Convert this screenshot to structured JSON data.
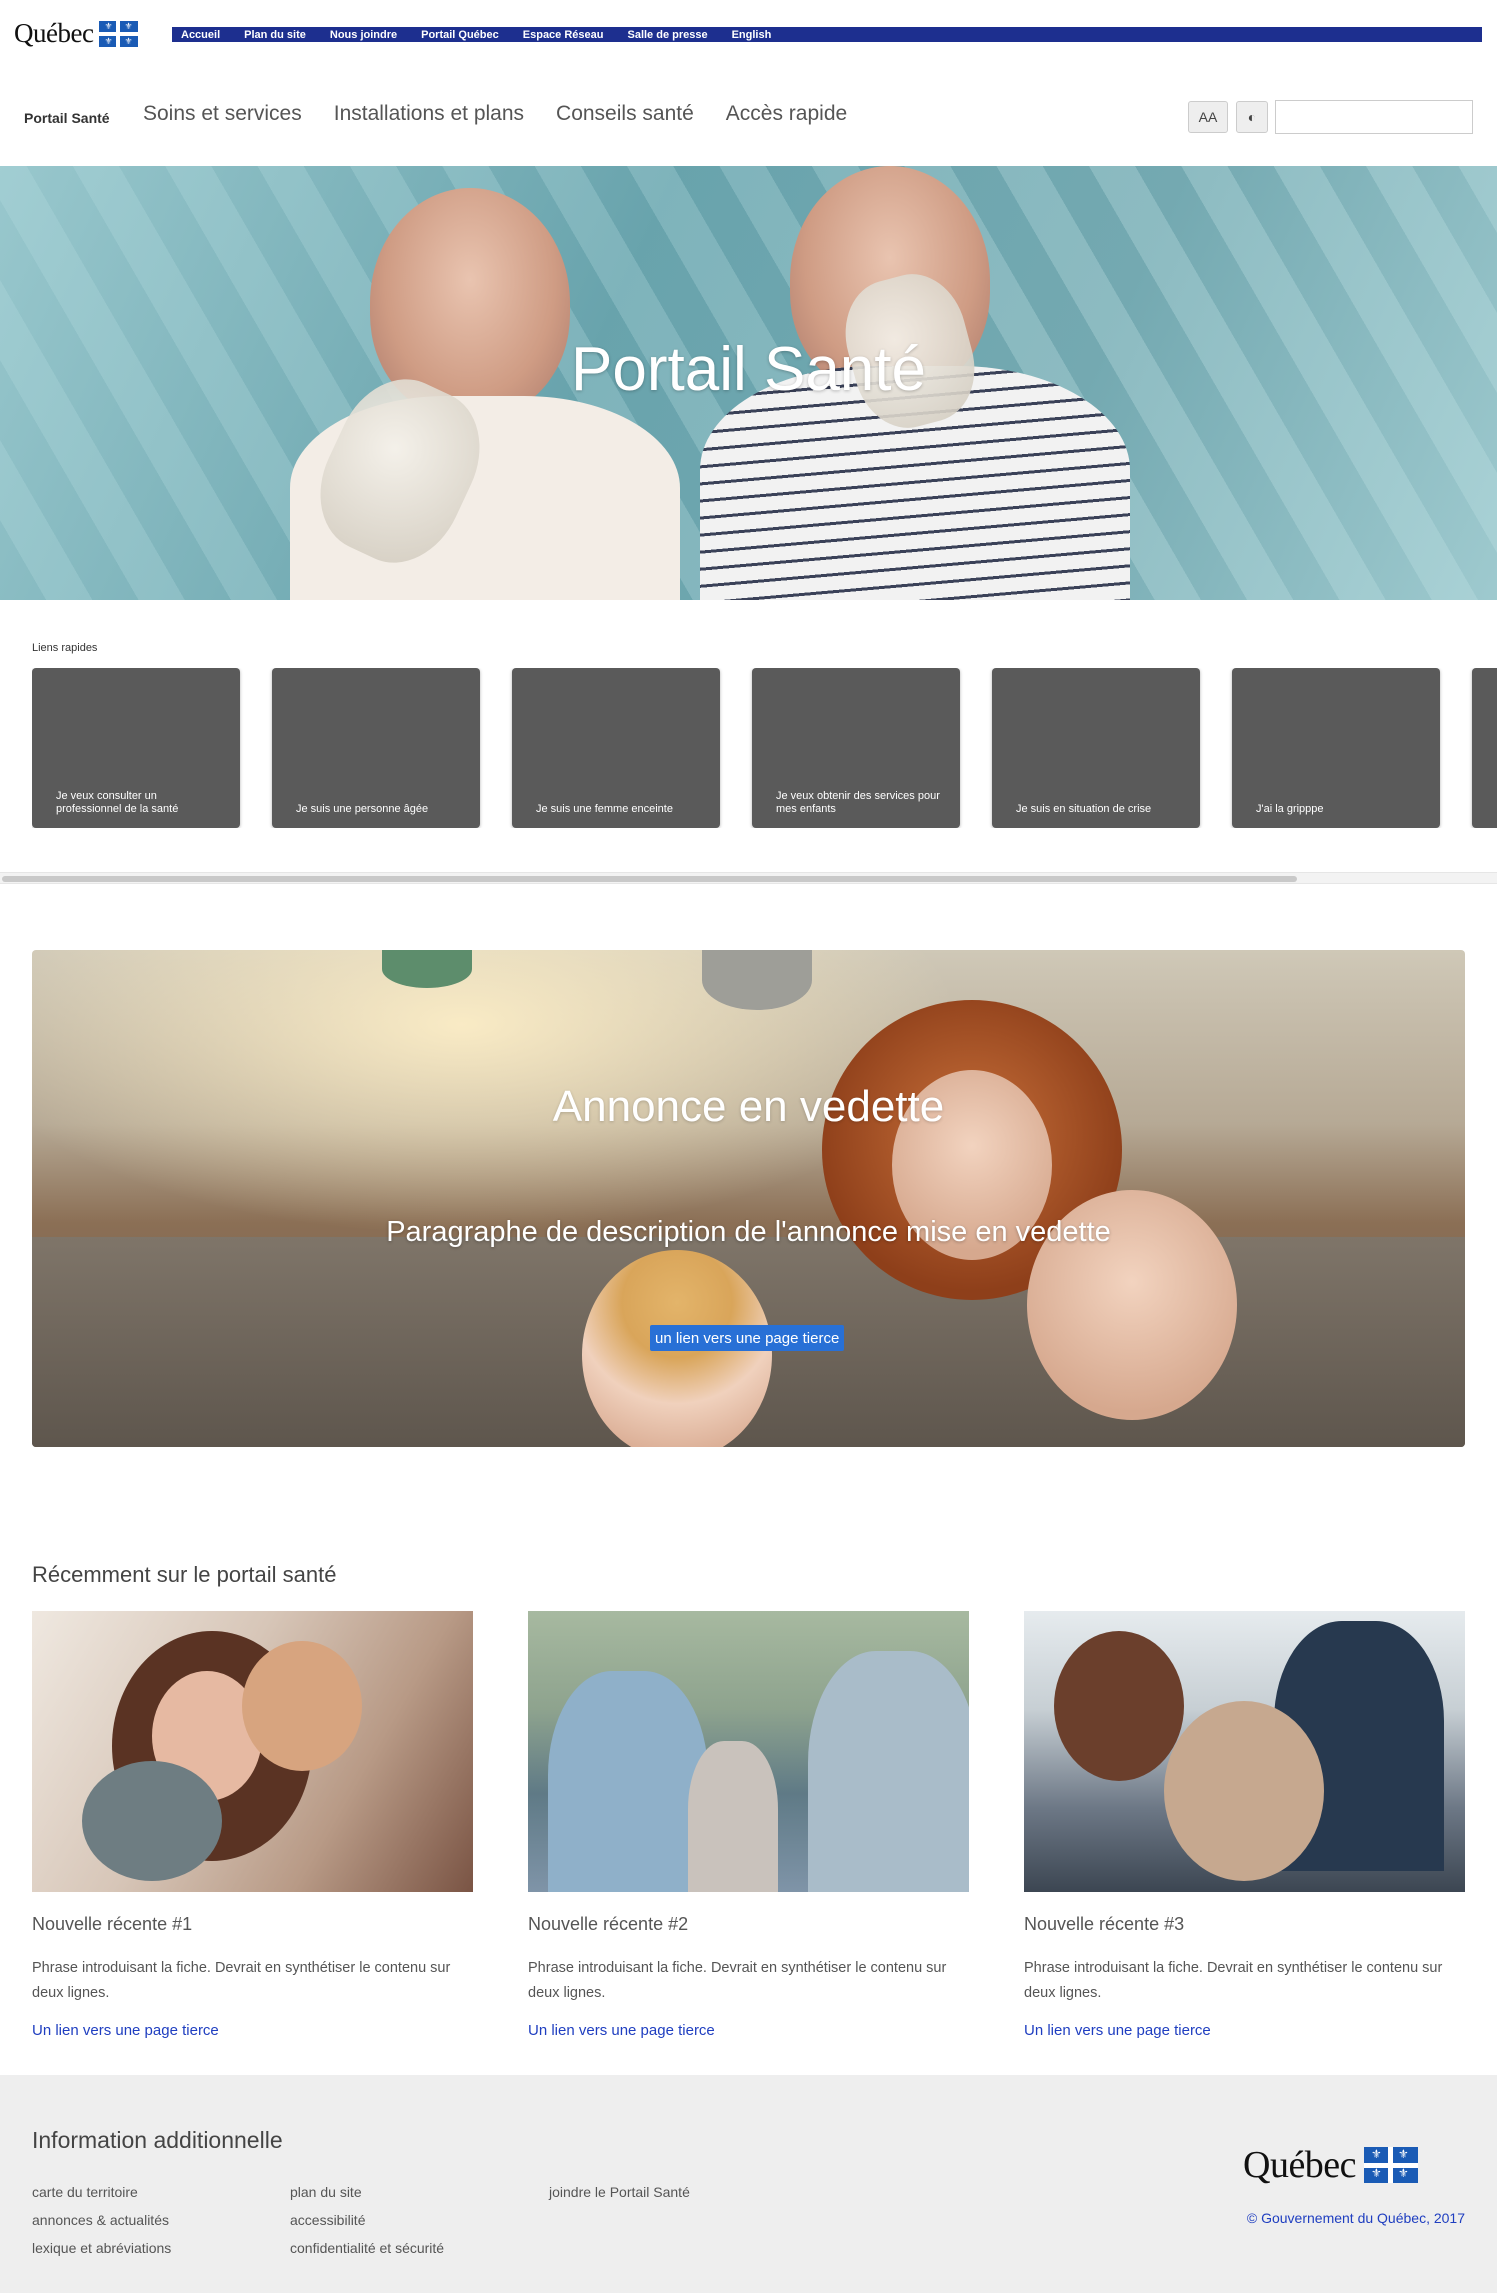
{
  "gov": {
    "logo_text": "Québec",
    "links": [
      "Accueil",
      "Plan du site",
      "Nous joindre",
      "Portail Québec",
      "Espace Réseau",
      "Salle de presse",
      "English"
    ]
  },
  "nav": {
    "brand": "Portail Santé",
    "items": [
      "Soins et services",
      "Installations et plans",
      "Conseils santé",
      "Accès rapide"
    ],
    "font_button": "AA",
    "contrast_icon": "◐",
    "search_value": ""
  },
  "hero": {
    "title": "Portail Santé"
  },
  "quick_links": {
    "label": "Liens rapides",
    "cards": [
      "Je veux consulter un professionnel de la santé",
      "Je suis une personne âgée",
      "Je suis une femme enceinte",
      "Je veux obtenir des services pour mes enfants",
      "Je suis en situation de crise",
      "J'ai la gripppe"
    ]
  },
  "featured": {
    "title": "Annonce en vedette",
    "description": "Paragraphe de description de l'annonce mise en vedette",
    "link": "un lien vers une page tierce"
  },
  "recent": {
    "title": "Récemment sur le portail santé",
    "items": [
      {
        "title": "Nouvelle récente #1",
        "text": "Phrase introduisant la fiche. Devrait en synthétiser le contenu sur deux lignes.",
        "link": "Un lien vers une page tierce"
      },
      {
        "title": "Nouvelle récente #2",
        "text": "Phrase introduisant la fiche. Devrait en synthétiser le contenu sur deux lignes.",
        "link": "Un lien vers une page tierce"
      },
      {
        "title": "Nouvelle récente #3",
        "text": "Phrase introduisant la fiche. Devrait en synthétiser le contenu sur deux lignes.",
        "link": "Un lien vers une page tierce"
      }
    ]
  },
  "footer": {
    "title": "Information additionnelle",
    "col1": [
      "carte du territoire",
      "annonces & actualités",
      "lexique et abréviations"
    ],
    "col2": [
      "plan du site",
      "accessibilité",
      "confidentialité et sécurité"
    ],
    "col3": [
      "joindre le Portail Santé"
    ],
    "logo_text": "Québec",
    "copyright": "© Gouvernement du Québec, 2017"
  },
  "colors": {
    "gov_bar": "#1d2f8f",
    "flag_blue": "#1a5bb5",
    "card_gray": "#5a5a5a",
    "link_blue": "#1f3ec0",
    "button_blue": "#2870d6",
    "footer_bg": "#eeeeee"
  }
}
